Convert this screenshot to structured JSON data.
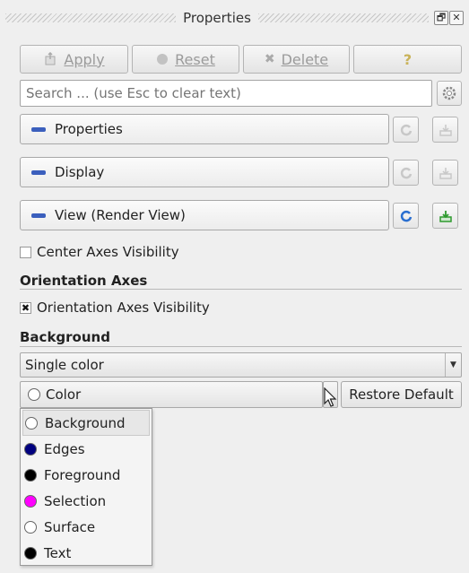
{
  "panel": {
    "title": "Properties",
    "float_glyph": "🗗",
    "close_glyph": "✕"
  },
  "toolbar": {
    "apply_label": "Apply",
    "reset_label": "Reset",
    "delete_label": "Delete",
    "help_label": "?"
  },
  "search": {
    "placeholder": "Search ... (use Esc to clear text)"
  },
  "sections": [
    {
      "label": "Properties"
    },
    {
      "label": "Display"
    },
    {
      "label": "View (Render View)"
    }
  ],
  "center_axes": {
    "label": "Center Axes Visibility",
    "checked": false,
    "mark": ""
  },
  "orientation_axes": {
    "heading": "Orientation Axes",
    "visibility_label": "Orientation Axes Visibility",
    "checked": true,
    "mark": "✖"
  },
  "background": {
    "heading": "Background",
    "mode_selected": "Single color",
    "select_arrow": "▼",
    "color_label": "Color",
    "restore_label": "Restore Default"
  },
  "color_menu": {
    "items": [
      {
        "label": "Background",
        "color": "#ffffff"
      },
      {
        "label": "Edges",
        "color": "#00007f"
      },
      {
        "label": "Foreground",
        "color": "#000000"
      },
      {
        "label": "Selection",
        "color": "#ff00ff"
      },
      {
        "label": "Surface",
        "color": "#ffffff"
      },
      {
        "label": "Text",
        "color": "#000000"
      }
    ]
  },
  "colors": {
    "section_accent": "#3b5fbd",
    "active_icon": "#2a6fd0",
    "download_active": "#2e9a2e"
  }
}
